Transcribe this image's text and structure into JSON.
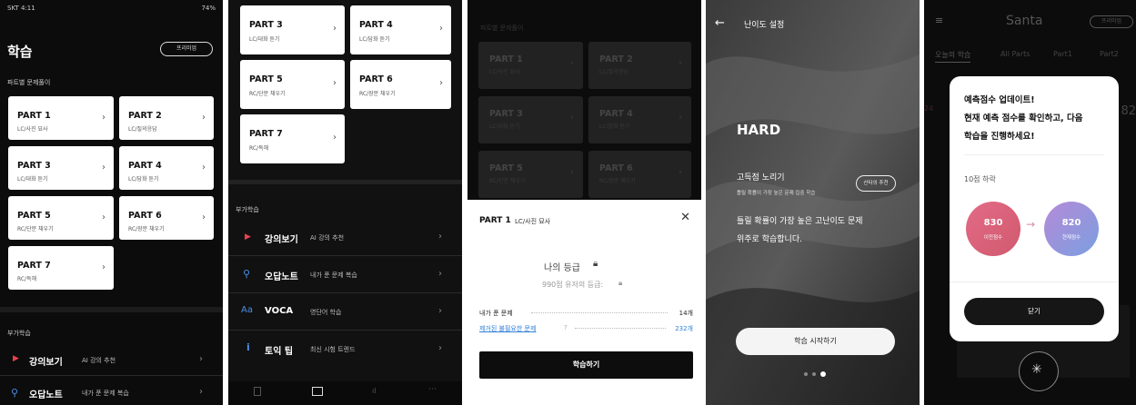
{
  "s1": {
    "status_left": "SKT 4:11",
    "status_right": "74%",
    "title": "학습",
    "premium": "프리미엄",
    "section": "파트별 문제풀이",
    "parts": [
      {
        "title": "PART 1",
        "sub": "LC/사진 묘사"
      },
      {
        "title": "PART 2",
        "sub": "LC/질의응답"
      },
      {
        "title": "PART 3",
        "sub": "LC/대화 듣기"
      },
      {
        "title": "PART 4",
        "sub": "LC/담화 듣기"
      },
      {
        "title": "PART 5",
        "sub": "RC/단문 채우기"
      },
      {
        "title": "PART 6",
        "sub": "RC/장문 채우기"
      },
      {
        "title": "PART 7",
        "sub": "RC/독해"
      }
    ],
    "extra_section": "부가학습",
    "extras": [
      {
        "label": "강의보기",
        "sub": "AI 강의 추천"
      },
      {
        "label": "오답노트",
        "sub": "내가 푼 문제 복습"
      }
    ]
  },
  "s2": {
    "parts": [
      {
        "title": "PART 3",
        "sub": "LC/대화 듣기"
      },
      {
        "title": "PART 4",
        "sub": "LC/담화 듣기"
      },
      {
        "title": "PART 5",
        "sub": "RC/단문 채우기"
      },
      {
        "title": "PART 6",
        "sub": "RC/장문 채우기"
      },
      {
        "title": "PART 7",
        "sub": "RC/독해"
      }
    ],
    "extra_section": "부가학습",
    "extras": [
      {
        "label": "강의보기",
        "sub": "AI 강의 추천"
      },
      {
        "label": "오답노트",
        "sub": "내가 푼 문제 복습"
      },
      {
        "label": "VOCA",
        "sub": "영단어 학습"
      },
      {
        "label": "토익 팁",
        "sub": "최신 시험 트렌드"
      }
    ],
    "icon_voca": "Aa",
    "icon_tip": "i"
  },
  "s3": {
    "section": "파트별 문제풀이",
    "parts": [
      {
        "title": "PART 1",
        "sub": "LC/사진 묘사"
      },
      {
        "title": "PART 2",
        "sub": "LC/질의응답"
      },
      {
        "title": "PART 3",
        "sub": "LC/대화 듣기"
      },
      {
        "title": "PART 4",
        "sub": "LC/담화 듣기"
      },
      {
        "title": "PART 5",
        "sub": "RC/단문 채우기"
      },
      {
        "title": "PART 6",
        "sub": "RC/장문 채우기"
      }
    ],
    "sheet_title": "PART 1",
    "sheet_sub": "LC/사진 묘사",
    "grade_label": "나의 등급",
    "grade_990": "990점 유저의 등급:",
    "solved_label": "내가 푼 문제",
    "solved_value": "14개",
    "removed_label": "제거된 불필요한 문제",
    "removed_value": "232개",
    "study_button": "학습하기"
  },
  "s4": {
    "header": "난이도 설정",
    "level": "HARD",
    "tag_title": "고득점 노리기",
    "tag_sub": "틀릴 확률이 가장 높은 문제 집중 학습",
    "badge": "산타의 추천",
    "desc1": "틀릴 확률이 가장 높은 고난이도 문제",
    "desc2": "위주로 학습합니다.",
    "start_button": "학습 시작하기"
  },
  "s5": {
    "logo": "Santa",
    "premium": "프리미엄",
    "tabs": [
      "오늘의 학습",
      "All Parts",
      "Part1",
      "Part2"
    ],
    "modal_line1": "예측점수 업데이트!",
    "modal_line2": "현재 예측 점수를 확인하고, 다음",
    "modal_line3": "학습을 진행하세요!",
    "drop_text": "10점 하락",
    "prev_score": "830",
    "prev_label": "이전점수",
    "cur_score": "820",
    "cur_label": "현재점수",
    "close_button": "닫기",
    "side_left": "24",
    "side_right": "82"
  }
}
